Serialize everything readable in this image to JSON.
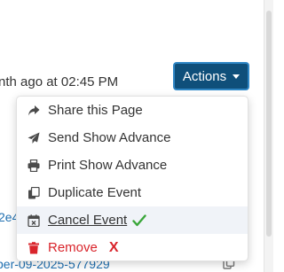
{
  "timestamp_text": "nth ago at 02:45 PM",
  "actions_button": {
    "label": "Actions"
  },
  "menu": {
    "items": [
      {
        "label": "Share this Page",
        "icon": "share-icon"
      },
      {
        "label": "Send Show Advance",
        "icon": "send-icon"
      },
      {
        "label": "Print Show Advance",
        "icon": "print-icon"
      },
      {
        "label": "Duplicate Event",
        "icon": "duplicate-icon"
      },
      {
        "label": "Cancel Event",
        "icon": "calendar-x-icon",
        "marker": "check-icon",
        "marker_color": "#3aa63a"
      },
      {
        "label": "Remove",
        "icon": "trash-icon",
        "marker": "X",
        "marker_color": "#d9242b"
      }
    ]
  },
  "background": {
    "fragment_1": "2e4",
    "fragment_2": "ber-09-2025-577929",
    "copy_icon": "copy-icon"
  },
  "colors": {
    "button_bg": "#0f4f7a",
    "button_border": "#2f86c5",
    "danger": "#d9242b",
    "success": "#3aa63a",
    "link": "#1f6fb0"
  }
}
